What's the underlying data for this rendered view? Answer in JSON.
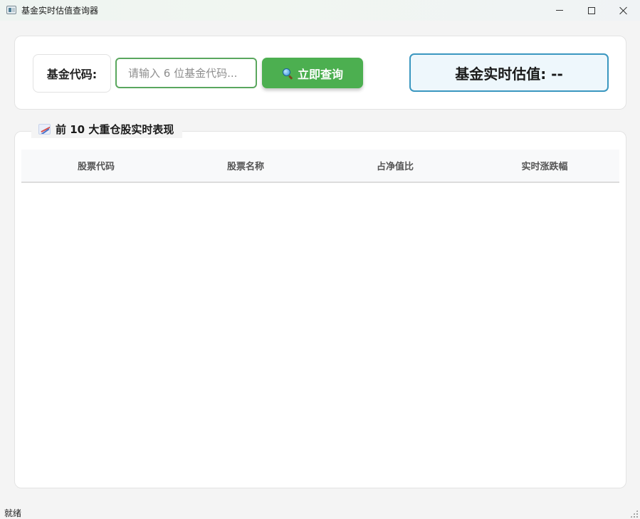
{
  "window": {
    "title": "基金实时估值查询器"
  },
  "search": {
    "code_label": "基金代码:",
    "placeholder": "请输入 6 位基金代码...",
    "value": "",
    "button_label": "立即查询"
  },
  "estimate": {
    "text": "基金实时估值: --"
  },
  "holdings": {
    "title": "前 10 大重仓股实时表现",
    "columns": [
      "股票代码",
      "股票名称",
      "占净值比",
      "实时涨跌幅"
    ],
    "rows": []
  },
  "status": {
    "text": "就绪"
  },
  "icons": {
    "app": "app-window-icon",
    "search": "magnifier-icon",
    "holdings": "chart-icon"
  },
  "colors": {
    "primary_green": "#4caf50",
    "input_border": "#5aa75e",
    "estimate_border": "#3a97c0",
    "estimate_bg": "#eef7fc"
  }
}
